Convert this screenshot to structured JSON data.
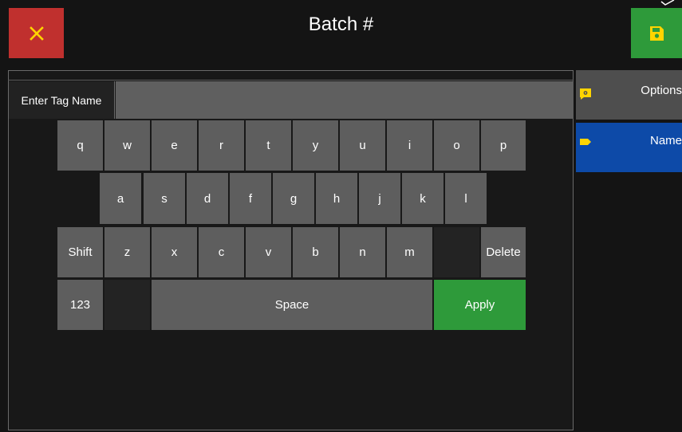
{
  "header": {
    "title": "Batch #",
    "close_label": "×",
    "colors": {
      "close": "#c0302e",
      "save": "#2e9a3a",
      "icon_yellow": "#ffd400"
    }
  },
  "input": {
    "label": "Enter Tag Name",
    "value": "",
    "placeholder": ""
  },
  "keyboard": {
    "row1": [
      "q",
      "w",
      "e",
      "r",
      "t",
      "y",
      "u",
      "i",
      "o",
      "p"
    ],
    "row2": [
      "a",
      "s",
      "d",
      "f",
      "g",
      "h",
      "j",
      "k",
      "l"
    ],
    "row3": [
      "Shift",
      "z",
      "x",
      "c",
      "v",
      "b",
      "n",
      "m",
      "",
      "Delete"
    ],
    "row4": [
      "123",
      "",
      "Space",
      "Apply"
    ]
  },
  "sidebar": {
    "items": [
      {
        "label": "Options",
        "icon": "settings-chat-icon",
        "selected": false
      },
      {
        "label": "Name",
        "icon": "tag-icon",
        "selected": true
      }
    ],
    "colors": {
      "selected": "#0d4aa8",
      "normal": "#4e4e4e"
    }
  }
}
